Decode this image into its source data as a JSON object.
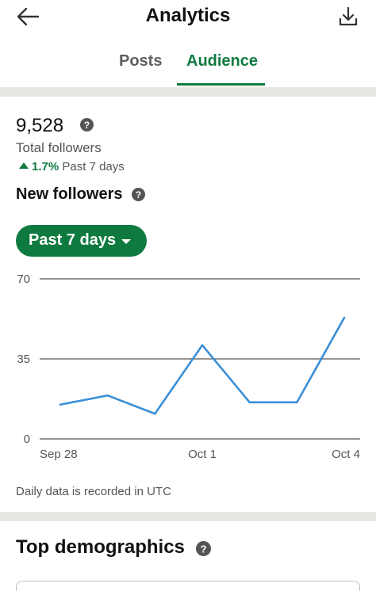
{
  "header": {
    "title": "Analytics",
    "back_icon": "arrow-left-icon",
    "download_icon": "download-icon"
  },
  "tabs": [
    {
      "label": "Posts",
      "active": false
    },
    {
      "label": "Audience",
      "active": true
    }
  ],
  "summary": {
    "total_value": "9,528",
    "total_label": "Total followers",
    "growth_pct": "1.7%",
    "growth_period": "Past 7 days"
  },
  "new_followers": {
    "title": "New followers",
    "range_label": "Past 7 days"
  },
  "chart_data": {
    "type": "line",
    "x": [
      "Sep 28",
      "Sep 29",
      "Sep 30",
      "Oct 1",
      "Oct 2",
      "Oct 3",
      "Oct 4"
    ],
    "x_tick_labels": [
      "Sep 28",
      "Oct 1",
      "Oct 4"
    ],
    "values": [
      15,
      19,
      11,
      41,
      16,
      16,
      53
    ],
    "ylim": [
      0,
      70
    ],
    "y_ticks": [
      0,
      35,
      70
    ],
    "grid": true,
    "line_color": "#3b8fd6"
  },
  "note": "Daily data is recorded in UTC",
  "demographics": {
    "title": "Top demographics"
  },
  "colors": {
    "accent": "#0f7a3f",
    "band": "#e9e7e1"
  }
}
